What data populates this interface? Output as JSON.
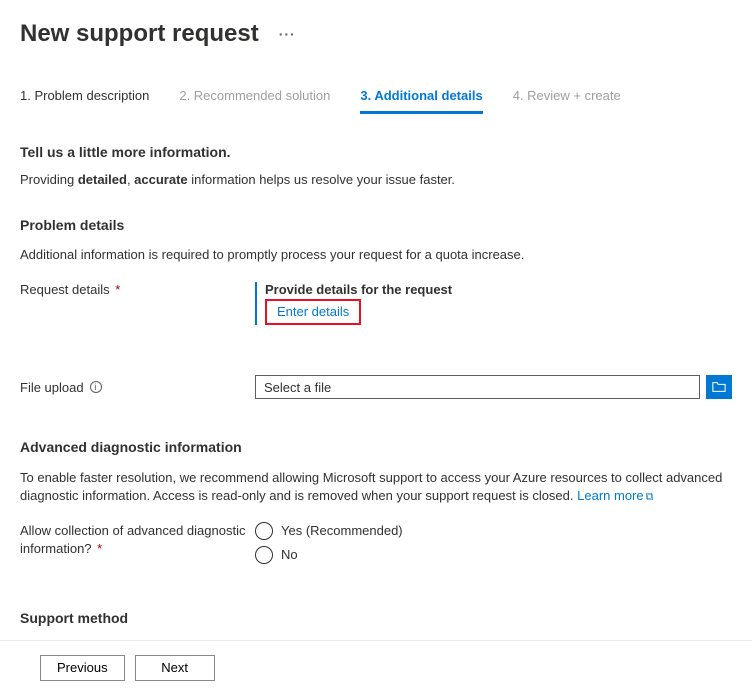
{
  "header": {
    "title": "New support request"
  },
  "tabs": [
    {
      "label": "1. Problem description",
      "state": "completed"
    },
    {
      "label": "2. Recommended solution",
      "state": "disabled"
    },
    {
      "label": "3. Additional details",
      "state": "active"
    },
    {
      "label": "4. Review + create",
      "state": "disabled"
    }
  ],
  "lead": {
    "heading": "Tell us a little more information.",
    "text_prefix": "Providing ",
    "strong1": "detailed",
    "sep": ", ",
    "strong2": "accurate",
    "text_suffix": " information helps us resolve your issue faster."
  },
  "problemDetails": {
    "heading": "Problem details",
    "desc": "Additional information is required to promptly process your request for a quota increase.",
    "requestDetailsLabel": "Request details",
    "provideTitle": "Provide details for the request",
    "enterDetails": "Enter details"
  },
  "fileUpload": {
    "label": "File upload",
    "placeholder": "Select a file"
  },
  "advanced": {
    "heading": "Advanced diagnostic information",
    "desc": "To enable faster resolution, we recommend allowing Microsoft support to access your Azure resources to collect advanced diagnostic information. Access is read-only and is removed when your support request is closed. ",
    "learnMore": "Learn more",
    "allowLabel": "Allow collection of advanced diagnostic information?",
    "yes": "Yes (Recommended)",
    "no": "No"
  },
  "supportMethod": {
    "heading": "Support method"
  },
  "footer": {
    "previous": "Previous",
    "next": "Next"
  }
}
